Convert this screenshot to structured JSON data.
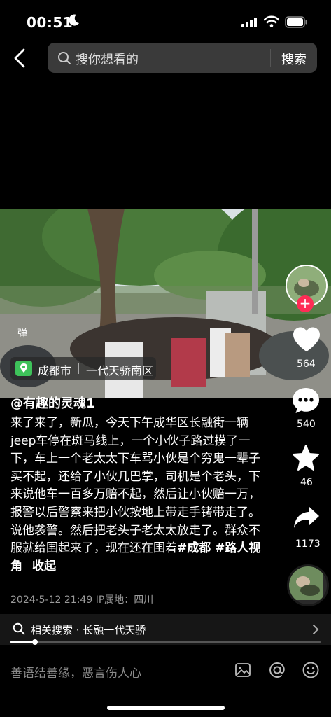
{
  "status_bar": {
    "time": "00:51"
  },
  "search": {
    "placeholder": "搜你想看的",
    "button": "搜索"
  },
  "video": {
    "danmu": "弹",
    "location": {
      "city": "成都市",
      "place": "一代天骄南区"
    }
  },
  "actions": {
    "follow_symbol": "+",
    "likes": "564",
    "comments": "540",
    "favorites": "46",
    "shares": "1173"
  },
  "post": {
    "author": "@有趣的灵魂1",
    "caption": "来了来了，新瓜，今天下午成华区长融街一辆jeep车停在斑马线上，一个小伙子路过摸了一下，车上一个老太太下车骂小伙是个穷鬼一辈子买不起，还给了小伙几巴掌，司机是个老头，下来说他车一百多万赔不起，然后让小伙赔一万，报警以后警察来把小伙按地上带走手铐带走了。说他袭警。然后把老头子老太太放走了。群众不服就给围起来了，现在还在围着",
    "hashtags": "#成都 #路人视角",
    "collapse": "收起",
    "meta": "2024-5-12 21:49 IP属地：四川"
  },
  "related": {
    "label": "相关搜索 · 长融一代天骄",
    "progress": 0.08
  },
  "comment_bar": {
    "placeholder": "善语结善缘，恶言伤人心"
  },
  "colors": {
    "accent": "#fe2c55",
    "background": "#000000"
  }
}
